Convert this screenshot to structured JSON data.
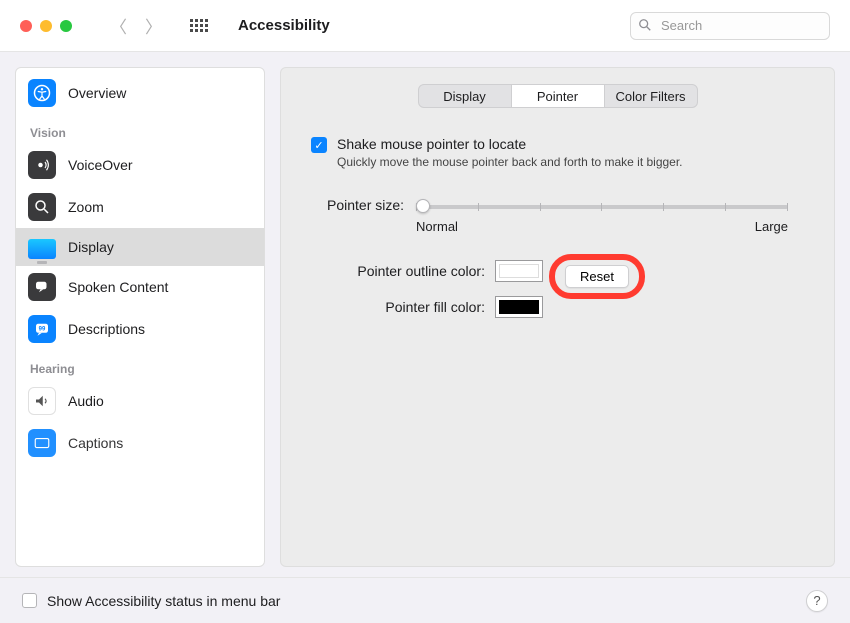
{
  "window": {
    "title": "Accessibility",
    "search_placeholder": "Search"
  },
  "sidebar": {
    "sections": [
      {
        "header": null,
        "items": [
          {
            "id": "overview",
            "label": "Overview",
            "icon": "accessibility-icon",
            "selected": false
          }
        ]
      },
      {
        "header": "Vision",
        "items": [
          {
            "id": "voiceover",
            "label": "VoiceOver",
            "icon": "voiceover-icon",
            "selected": false
          },
          {
            "id": "zoom",
            "label": "Zoom",
            "icon": "zoom-icon",
            "selected": false
          },
          {
            "id": "display",
            "label": "Display",
            "icon": "display-icon",
            "selected": true
          },
          {
            "id": "spoken",
            "label": "Spoken Content",
            "icon": "spoken-icon",
            "selected": false
          },
          {
            "id": "descriptions",
            "label": "Descriptions",
            "icon": "descriptions-icon",
            "selected": false
          }
        ]
      },
      {
        "header": "Hearing",
        "items": [
          {
            "id": "audio",
            "label": "Audio",
            "icon": "audio-icon",
            "selected": false
          },
          {
            "id": "captions",
            "label": "Captions",
            "icon": "captions-icon",
            "selected": false
          }
        ]
      }
    ]
  },
  "tabs": {
    "items": [
      "Display",
      "Pointer",
      "Color Filters"
    ],
    "selected": "Pointer"
  },
  "shake": {
    "label": "Shake mouse pointer to locate",
    "desc": "Quickly move the mouse pointer back and forth to make it bigger.",
    "checked": true
  },
  "slider": {
    "label": "Pointer size:",
    "min_label": "Normal",
    "max_label": "Large",
    "value": 0
  },
  "colors": {
    "outline_label": "Pointer outline color:",
    "outline_value": "#ffffff",
    "fill_label": "Pointer fill color:",
    "fill_value": "#000000",
    "reset_label": "Reset"
  },
  "footer": {
    "checkbox_label": "Show Accessibility status in menu bar",
    "help_label": "?"
  }
}
